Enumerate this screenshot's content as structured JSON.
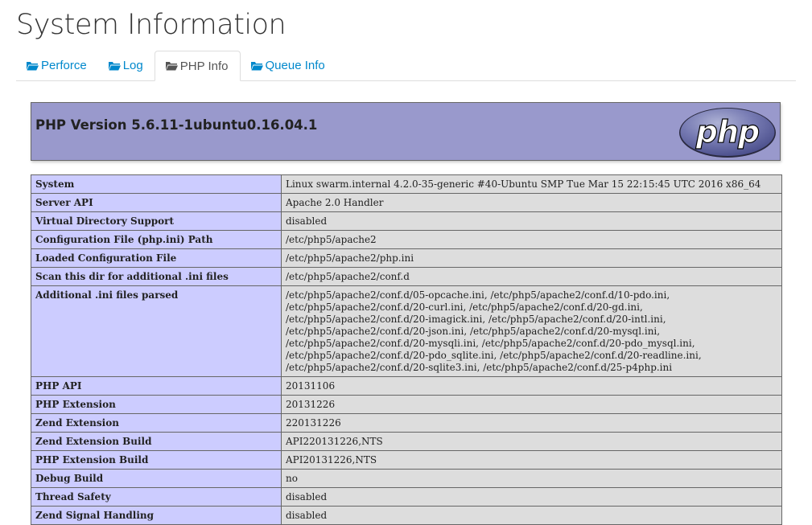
{
  "page": {
    "title": "System Information"
  },
  "tabs": [
    {
      "label": "Perforce",
      "icon": "folder-open-icon",
      "active": false
    },
    {
      "label": "Log",
      "icon": "folder-open-icon",
      "active": false
    },
    {
      "label": "PHP Info",
      "icon": "folder-open-icon",
      "active": true
    },
    {
      "label": "Queue Info",
      "icon": "folder-open-icon",
      "active": false
    }
  ],
  "php_header": {
    "version": "PHP Version 5.6.11-1ubuntu0.16.04.1",
    "logo_text": "php"
  },
  "info_rows": [
    {
      "key": "System",
      "value": "Linux swarm.internal 4.2.0-35-generic #40-Ubuntu SMP Tue Mar 15 22:15:45 UTC 2016 x86_64"
    },
    {
      "key": "Server API",
      "value": "Apache 2.0 Handler"
    },
    {
      "key": "Virtual Directory Support",
      "value": "disabled"
    },
    {
      "key": "Configuration File (php.ini) Path",
      "value": "/etc/php5/apache2"
    },
    {
      "key": "Loaded Configuration File",
      "value": "/etc/php5/apache2/php.ini"
    },
    {
      "key": "Scan this dir for additional .ini files",
      "value": "/etc/php5/apache2/conf.d"
    },
    {
      "key": "Additional .ini files parsed",
      "value": "/etc/php5/apache2/conf.d/05-opcache.ini, /etc/php5/apache2/conf.d/10-pdo.ini, /etc/php5/apache2/conf.d/20-curl.ini, /etc/php5/apache2/conf.d/20-gd.ini, /etc/php5/apache2/conf.d/20-imagick.ini, /etc/php5/apache2/conf.d/20-intl.ini, /etc/php5/apache2/conf.d/20-json.ini, /etc/php5/apache2/conf.d/20-mysql.ini, /etc/php5/apache2/conf.d/20-mysqli.ini, /etc/php5/apache2/conf.d/20-pdo_mysql.ini, /etc/php5/apache2/conf.d/20-pdo_sqlite.ini, /etc/php5/apache2/conf.d/20-readline.ini, /etc/php5/apache2/conf.d/20-sqlite3.ini, /etc/php5/apache2/conf.d/25-p4php.ini"
    },
    {
      "key": "PHP API",
      "value": "20131106"
    },
    {
      "key": "PHP Extension",
      "value": "20131226"
    },
    {
      "key": "Zend Extension",
      "value": "220131226"
    },
    {
      "key": "Zend Extension Build",
      "value": "API220131226,NTS"
    },
    {
      "key": "PHP Extension Build",
      "value": "API20131226,NTS"
    },
    {
      "key": "Debug Build",
      "value": "no"
    },
    {
      "key": "Thread Safety",
      "value": "disabled"
    },
    {
      "key": "Zend Signal Handling",
      "value": "disabled"
    }
  ],
  "colors": {
    "link": "#0088cc",
    "header_bg": "#9999cc",
    "key_bg": "#ccccff",
    "value_bg": "#dddddd"
  }
}
